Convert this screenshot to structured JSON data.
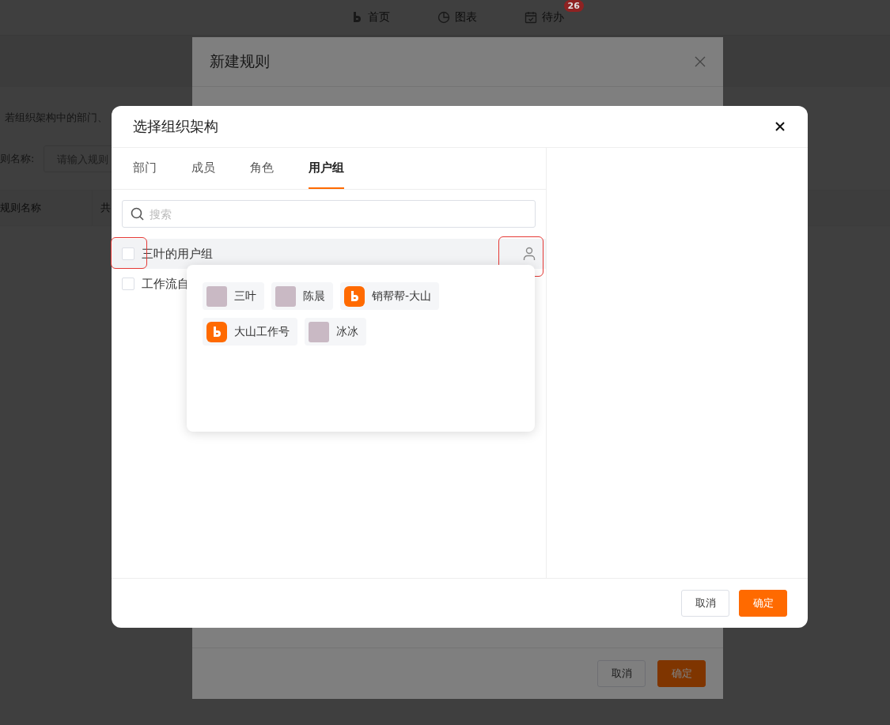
{
  "nav": {
    "items": [
      {
        "label": "首页"
      },
      {
        "label": "图表"
      },
      {
        "label": "待办",
        "badge": "26"
      }
    ]
  },
  "page": {
    "notice": "若组织架构中的部门、",
    "filter_label": "则名称:",
    "filter_placeholder": "请输入规则",
    "table_columns": [
      "规则名称",
      "共"
    ]
  },
  "rule_dialog": {
    "title": "新建规则",
    "buttons": [
      {
        "label": "取消",
        "kind": "secondary"
      },
      {
        "label": "确定",
        "kind": "primary"
      }
    ]
  },
  "org_dialog": {
    "title": "选择组织架构",
    "tabs": [
      {
        "label": "部门",
        "selected": false
      },
      {
        "label": "成员",
        "selected": false
      },
      {
        "label": "角色",
        "selected": false
      },
      {
        "label": "用户组",
        "selected": true
      }
    ],
    "search": {
      "placeholder": "搜索"
    },
    "groups": [
      {
        "name": "三叶的用户组",
        "checked": false,
        "highlighted": true
      },
      {
        "name": "工作流自",
        "checked": false,
        "highlighted": false
      }
    ],
    "popover": {
      "members": [
        {
          "name": "三叶",
          "kind": "photo"
        },
        {
          "name": "陈晨",
          "kind": "photo"
        },
        {
          "name": "销帮帮-大山",
          "kind": "logo"
        },
        {
          "name": "大山工作号",
          "kind": "logo"
        },
        {
          "name": "冰冰",
          "kind": "photo"
        }
      ]
    },
    "buttons": [
      {
        "label": "取消",
        "kind": "secondary"
      },
      {
        "label": "确定",
        "kind": "primary"
      }
    ]
  }
}
